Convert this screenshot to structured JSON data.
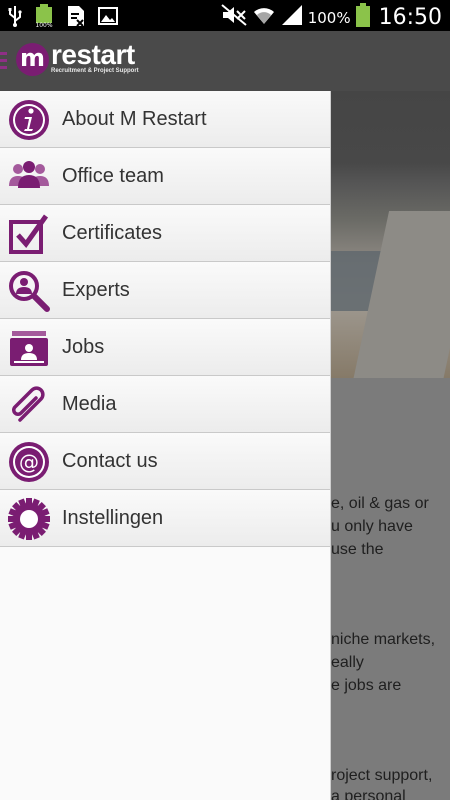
{
  "status_bar": {
    "icons": [
      "usb-icon",
      "battery-small-icon",
      "storage-icon",
      "image-icon",
      "mute-icon",
      "wifi-icon",
      "signal-icon",
      "battery-icon"
    ],
    "battery_pct": "100%",
    "clock": "16:50"
  },
  "app_bar": {
    "logo_letter": "m",
    "logo_word": "restart",
    "logo_tagline": "Recruitment & Project Support"
  },
  "drawer": {
    "items": [
      {
        "label": "About M Restart",
        "icon": "info-icon"
      },
      {
        "label": "Office team",
        "icon": "team-icon"
      },
      {
        "label": "Certificates",
        "icon": "checkbox-icon"
      },
      {
        "label": "Experts",
        "icon": "magnifier-person-icon"
      },
      {
        "label": "Jobs",
        "icon": "jobs-card-icon"
      },
      {
        "label": "Media",
        "icon": "paperclip-icon"
      },
      {
        "label": "Contact us",
        "icon": "at-sign-icon"
      },
      {
        "label": "Instellingen",
        "icon": "gear-icon"
      }
    ]
  },
  "background_text": {
    "lines": [
      "e, oil & gas or",
      "u only have",
      "use the",
      "niche markets,",
      "eally",
      "e jobs are",
      "roject support,",
      "a personal"
    ]
  },
  "colors": {
    "accent": "#7a1d72",
    "actionbar": "#4a4a4a",
    "statusbar": "#000000"
  }
}
